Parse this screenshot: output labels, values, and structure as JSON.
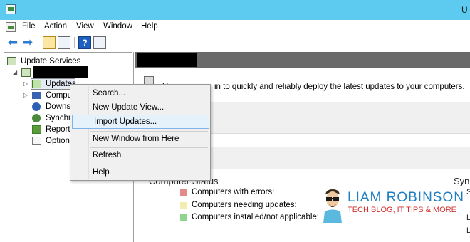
{
  "window": {
    "title": "U"
  },
  "menu": {
    "items": [
      "File",
      "Action",
      "View",
      "Window",
      "Help"
    ]
  },
  "toolbar": {
    "icons": [
      "back-arrow-icon",
      "forward-arrow-icon",
      "up-folder-icon",
      "show-hide-tree-icon",
      "help-icon",
      "properties-icon"
    ]
  },
  "tree": {
    "root": "Update Services",
    "items": [
      {
        "label": "Updates",
        "icon": "updates-icon"
      },
      {
        "label": "Compu",
        "icon": "computers-icon"
      },
      {
        "label": "Downs",
        "icon": "downstream-servers-icon"
      },
      {
        "label": "Synchr",
        "icon": "synchronizations-icon"
      },
      {
        "label": "Reports",
        "icon": "reports-icon"
      },
      {
        "label": "Option",
        "icon": "options-icon"
      }
    ]
  },
  "main": {
    "intro_prefix": "U",
    "intro_text": "in to quickly and reliably deploy the latest updates to your computers.",
    "section_title": "Computer Status",
    "right_title": "Sync",
    "right_chars": [
      "S",
      "L",
      "L"
    ],
    "status_items": [
      {
        "label": "Computers with errors:",
        "color": "#e38a8a"
      },
      {
        "label": "Computers needing updates:",
        "color": "#f5ecb0"
      },
      {
        "label": "Computers installed/not applicable:",
        "color": "#8fd48f"
      }
    ]
  },
  "context_menu": {
    "items": [
      "Search...",
      "New Update View...",
      "Import Updates...",
      "New Window from Here",
      "Refresh",
      "Help"
    ],
    "highlighted": "Import Updates..."
  },
  "watermark": {
    "name": "LIAM ROBINSON",
    "tagline": "TECH BLOG, IT TIPS & MORE"
  }
}
